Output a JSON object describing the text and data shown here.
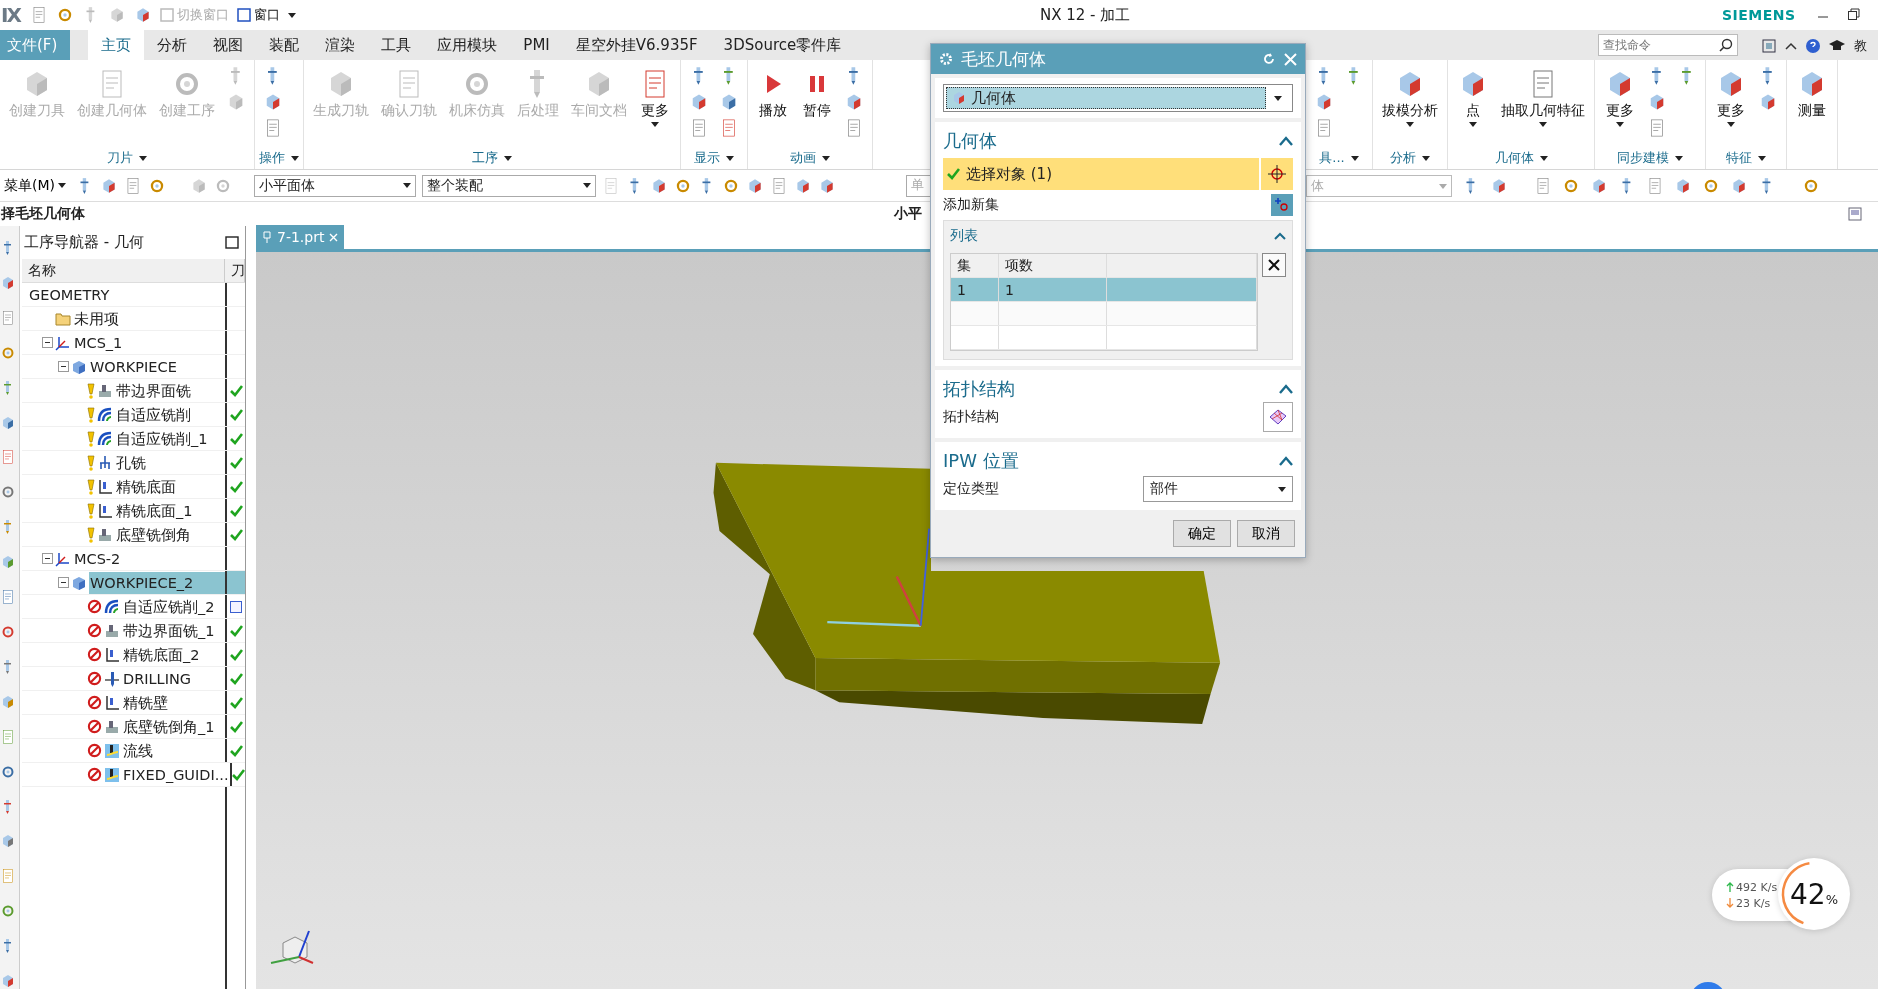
{
  "title_bar": {
    "logo": "IX",
    "title": "NX 12 - 加工",
    "brand": "SIEMENS",
    "quick_access": [
      {
        "label": "切换窗口",
        "disabled": true
      },
      {
        "label": "窗口",
        "disabled": false
      }
    ]
  },
  "menu_tabs": [
    {
      "label": "文件(F)",
      "kind": "file"
    },
    {
      "label": "主页",
      "kind": "tab",
      "selected": true
    },
    {
      "label": "分析",
      "kind": "tab",
      "selected": false
    },
    {
      "label": "视图",
      "kind": "tab",
      "selected": false
    },
    {
      "label": "装配",
      "kind": "tab",
      "selected": false
    },
    {
      "label": "渲染",
      "kind": "tab",
      "selected": false
    },
    {
      "label": "工具",
      "kind": "tab",
      "selected": false
    },
    {
      "label": "应用模块",
      "kind": "tab",
      "selected": false
    },
    {
      "label": "PMI",
      "kind": "tab",
      "selected": false
    },
    {
      "label": "星空外挂V6.935F",
      "kind": "tab",
      "selected": false
    },
    {
      "label": "3DSource零件库",
      "kind": "tab",
      "selected": false
    }
  ],
  "search": {
    "placeholder": "查找命令"
  },
  "help_label": "教",
  "ribbon": {
    "left_groups": [
      {
        "label": "刀片",
        "buttons": [
          {
            "label": "创建刀具",
            "kind": "plain",
            "disabled": true
          },
          {
            "label": "创建几何体",
            "kind": "plain",
            "disabled": true
          },
          {
            "label": "创建工序",
            "kind": "plain",
            "disabled": true
          }
        ]
      },
      {
        "label": "操作"
      },
      {
        "label": "工序",
        "buttons": [
          {
            "label": "生成刀轨",
            "kind": "plain",
            "disabled": true
          },
          {
            "label": "确认刀轨",
            "kind": "plain",
            "disabled": true
          },
          {
            "label": "机床仿真",
            "kind": "plain",
            "disabled": true
          },
          {
            "label": "后处理",
            "kind": "plain",
            "disabled": true
          },
          {
            "label": "车间文档",
            "kind": "plain",
            "disabled": true
          },
          {
            "label": "更多",
            "kind": "menu",
            "disabled": false
          }
        ]
      },
      {
        "label": "显示"
      },
      {
        "label": "动画",
        "buttons": [
          {
            "label": "播放",
            "kind": "play",
            "disabled": false
          },
          {
            "label": "暂停",
            "kind": "pause",
            "disabled": false
          }
        ]
      }
    ],
    "right_groups": [
      {
        "label": "具..."
      },
      {
        "label": "分析",
        "buttons": [
          {
            "label": "拔模分析",
            "kind": "menu",
            "disabled": false
          }
        ]
      },
      {
        "label": "几何体",
        "buttons": [
          {
            "label": "点",
            "kind": "menu",
            "disabled": false
          },
          {
            "label": "抽取几何特征",
            "kind": "menu",
            "disabled": false
          }
        ]
      },
      {
        "label": "同步建模",
        "buttons": [
          {
            "label": "更多",
            "kind": "menu",
            "disabled": false
          }
        ]
      },
      {
        "label": "特征",
        "buttons": [
          {
            "label": "更多",
            "kind": "menu",
            "disabled": false
          }
        ]
      },
      {
        "buttons": [
          {
            "label": "测量",
            "kind": "plain",
            "disabled": false
          }
        ]
      }
    ]
  },
  "toolbar": {
    "menu_label": "菜单(M)",
    "filters": [
      {
        "value": "小平面体"
      },
      {
        "value": "整个装配"
      }
    ],
    "cut_field": "单",
    "right_field": "体"
  },
  "prompt": {
    "text": "择毛坯几何体",
    "cut_text": "小平"
  },
  "navigator": {
    "title": "工序导航器 - 几何",
    "columns": [
      "名称",
      "刀"
    ],
    "tree": [
      {
        "label": "GEOMETRY",
        "selected": false,
        "children": [
          {
            "label": "未用项",
            "kind": "folder",
            "selected": false
          },
          {
            "label": "MCS_1",
            "kind": "mcs",
            "selected": false,
            "expanded": true,
            "children": [
              {
                "label": "WORKPIECE",
                "kind": "workpiece",
                "selected": false,
                "expanded": true,
                "children": [
                  {
                    "label": "带边界面铣",
                    "kind": "face",
                    "blocked": false,
                    "tool_ok": true,
                    "selected": false
                  },
                  {
                    "label": "自适应铣削",
                    "kind": "adaptive",
                    "blocked": false,
                    "tool_ok": true,
                    "selected": false
                  },
                  {
                    "label": "自适应铣削_1",
                    "kind": "adaptive",
                    "blocked": false,
                    "tool_ok": true,
                    "selected": false
                  },
                  {
                    "label": "孔铣",
                    "kind": "hole",
                    "blocked": false,
                    "tool_ok": true,
                    "selected": false
                  },
                  {
                    "label": "精铣底面",
                    "kind": "floor",
                    "blocked": false,
                    "tool_ok": true,
                    "selected": false
                  },
                  {
                    "label": "精铣底面_1",
                    "kind": "floor",
                    "blocked": false,
                    "tool_ok": true,
                    "selected": false
                  },
                  {
                    "label": "底壁铣倒角",
                    "kind": "face",
                    "blocked": false,
                    "tool_ok": true,
                    "selected": false
                  }
                ]
              }
            ]
          },
          {
            "label": "MCS-2",
            "kind": "mcs",
            "selected": false,
            "expanded": true,
            "children": [
              {
                "label": "WORKPIECE_2",
                "kind": "workpiece",
                "selected": true,
                "expanded": true,
                "children": [
                  {
                    "label": "自适应铣削_2",
                    "kind": "adaptive",
                    "blocked": true,
                    "tool_ok": false,
                    "selected": false
                  },
                  {
                    "label": "带边界面铣_1",
                    "kind": "face",
                    "blocked": true,
                    "tool_ok": true,
                    "selected": false
                  },
                  {
                    "label": "精铣底面_2",
                    "kind": "floor",
                    "blocked": true,
                    "tool_ok": true,
                    "selected": false
                  },
                  {
                    "label": "DRILLING",
                    "kind": "drill",
                    "blocked": true,
                    "tool_ok": true,
                    "selected": false
                  },
                  {
                    "label": "精铣壁",
                    "kind": "floor",
                    "blocked": true,
                    "tool_ok": true,
                    "selected": false
                  },
                  {
                    "label": "底壁铣倒角_1",
                    "kind": "face",
                    "blocked": true,
                    "tool_ok": true,
                    "selected": false
                  },
                  {
                    "label": "流线",
                    "kind": "stream",
                    "blocked": true,
                    "tool_ok": true,
                    "selected": false
                  },
                  {
                    "label": "FIXED_GUIDI...",
                    "kind": "stream",
                    "blocked": true,
                    "tool_ok": true,
                    "selected": false
                  }
                ]
              }
            ]
          }
        ]
      }
    ]
  },
  "file_tab": {
    "label": "7-1.prt"
  },
  "dialog": {
    "title": "毛坯几何体",
    "type_value": "几何体",
    "geometry_section": {
      "title": "几何体",
      "select_label": "选择对象 (1)",
      "select_done": true,
      "add_label": "添加新集",
      "list": {
        "title": "列表",
        "columns": [
          "集",
          "项数"
        ],
        "rows": [
          {
            "cells": [
              "1",
              "1"
            ],
            "selected": true
          }
        ]
      }
    },
    "topology_section": {
      "title": "拓扑结构",
      "label": "拓扑结构"
    },
    "ipw_section": {
      "title": "IPW 位置",
      "label": "定位类型",
      "value": "部件"
    },
    "buttons": [
      "确定",
      "取消"
    ]
  },
  "net_monitor": {
    "up": "492 K/s",
    "down": "23 K/s",
    "percent": "42",
    "unit": "%"
  }
}
